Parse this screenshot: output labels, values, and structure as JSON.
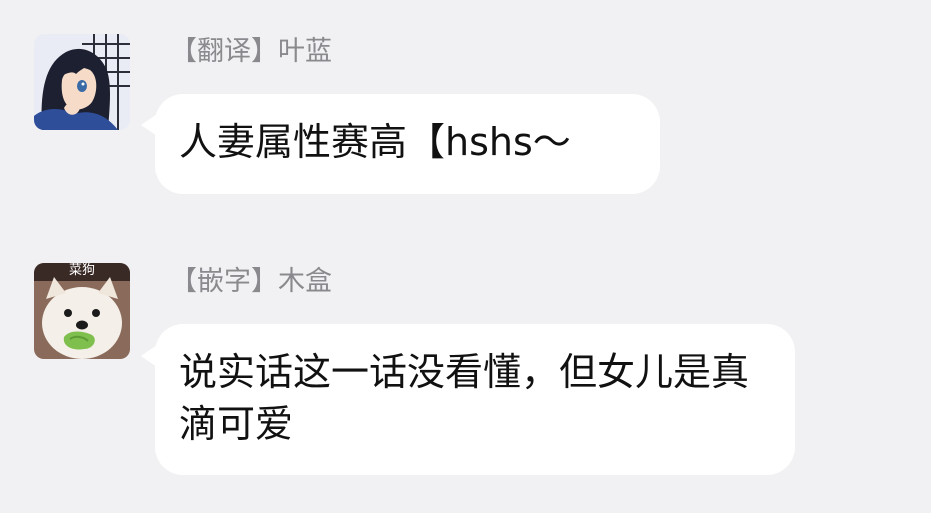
{
  "messages": [
    {
      "sender": "【翻译】叶蓝",
      "text": "人妻属性赛高【hshs～",
      "avatar": "anime-girl-avatar-icon"
    },
    {
      "sender": "【嵌字】木盒",
      "text": "说实话这一话没看懂，但女儿是真滴可爱",
      "avatar": "dog-avatar-icon",
      "avatar_label": "菜狗"
    }
  ],
  "colors": {
    "background": "#f1f1f3",
    "bubble": "#ffffff",
    "sender_text": "#8a8a8e",
    "message_text": "#111111"
  }
}
